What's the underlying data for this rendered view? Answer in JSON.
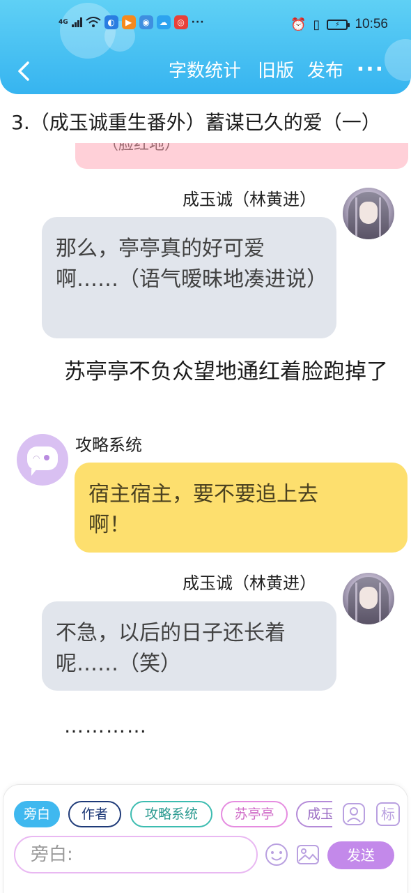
{
  "colors": {
    "header_top": "#5fd0f5",
    "header_bottom": "#36b4f0",
    "gray_bubble": "#e1e5ec",
    "yellow_bubble": "#fddf6e",
    "pink_bubble": "#ffd0d8",
    "system_avatar": "#d9c0f2",
    "send_button": "#c389ea"
  },
  "status_bar": {
    "signal_label": "4G",
    "overflow": "···",
    "vibrate_icon": "vibrate-icon",
    "time": "10:56"
  },
  "header": {
    "back_icon": "chevron-left-icon",
    "word_count": "字数统计",
    "old_version": "旧版",
    "publish": "发布",
    "more": "···"
  },
  "chapter_title": "3.（成玉诚重生番外）蓄谋已久的爱（一）",
  "cut_bubble_text": "（脸红地）",
  "messages": [
    {
      "speaker": "成玉诚（林黄进）",
      "text": "那么，亭亭真的好可爱啊……（语气暧昧地凑进说）"
    },
    {
      "narration": "苏亭亭不负众望地通红着脸跑掉了"
    },
    {
      "speaker": "攻略系统",
      "text": "宿主宿主，要不要追上去啊！"
    },
    {
      "speaker": "成玉诚（林黄进）",
      "text": "不急，以后的日子还长着呢……（笑）"
    },
    {
      "narration": "…………"
    }
  ],
  "roles": [
    {
      "label": "旁白",
      "color": "#3fb8ef"
    },
    {
      "label": "作者",
      "color": "#1e3a78"
    },
    {
      "label": "攻略系统",
      "color": "#3cbcb0"
    },
    {
      "label": "苏亭亭",
      "color": "#e58ce0"
    },
    {
      "label": "成玉诚",
      "color": "#b48ad8"
    }
  ],
  "input": {
    "placeholder": "旁白:",
    "send_label": "发送",
    "mark_label": "标"
  }
}
